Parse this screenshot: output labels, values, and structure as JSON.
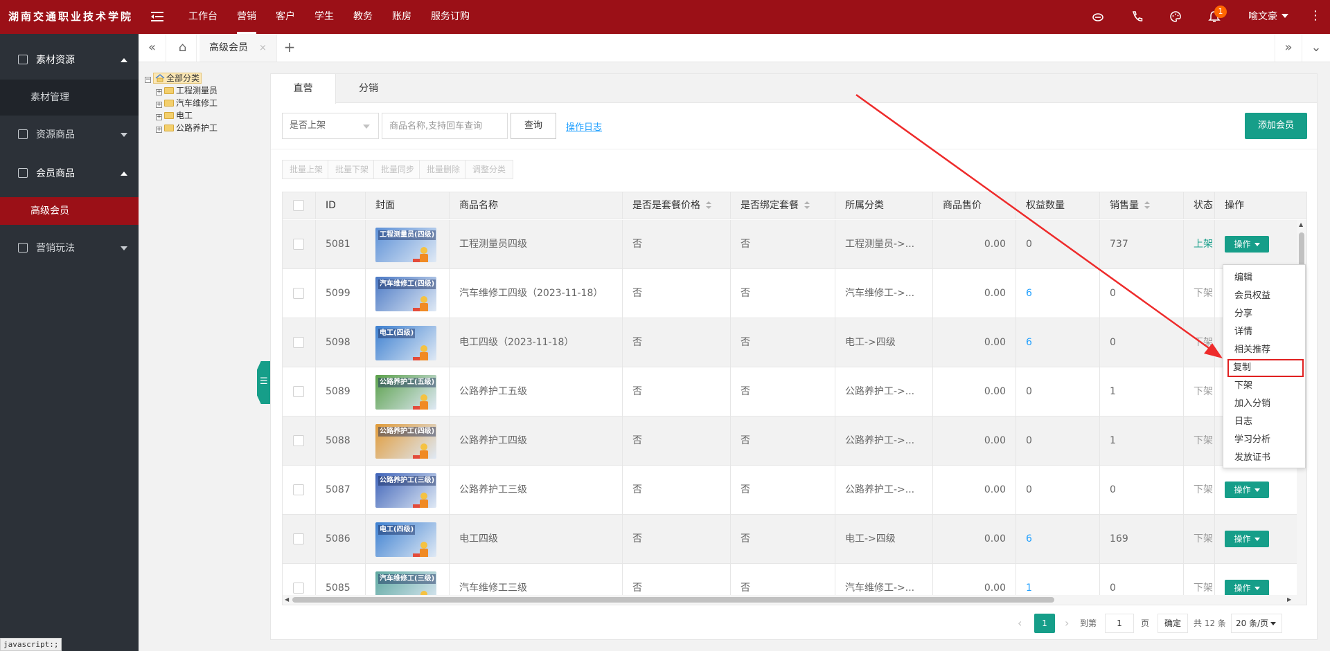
{
  "app": {
    "logo": "湖南交通职业技术学院",
    "nav": [
      "工作台",
      "营销",
      "客户",
      "学生",
      "教务",
      "账房",
      "服务订购"
    ],
    "nav_active_index": 1,
    "notification_count": "1",
    "user_name": "喻文豪",
    "accent_color": "#9b1017",
    "primary_color": "#169e89"
  },
  "sidebar": {
    "groups": [
      {
        "label": "素材资源",
        "icon": "document-icon",
        "expanded": true,
        "children": [
          "素材管理"
        ]
      },
      {
        "label": "资源商品",
        "icon": "list-icon",
        "expanded": false,
        "children": []
      },
      {
        "label": "会员商品",
        "icon": "book-icon",
        "expanded": true,
        "children": [
          "高级会员"
        ]
      },
      {
        "label": "营销玩法",
        "icon": "list-icon",
        "expanded": false,
        "children": []
      }
    ],
    "status_text": "javascript:;"
  },
  "tabbar": {
    "current_tab": "高级会员",
    "close_glyph": "×",
    "add_glyph": "+"
  },
  "tree": {
    "root": "全部分类",
    "items": [
      "工程测量员",
      "汽车维修工",
      "电工",
      "公路养护工"
    ]
  },
  "panel": {
    "tabs": [
      "直营",
      "分销"
    ],
    "active_tab_index": 0,
    "filter_status": "是否上架",
    "search_placeholder": "商品名称,支持回车查询",
    "query_label": "查询",
    "oplog_label": "操作日志",
    "add_member_label": "添加会员",
    "batch_buttons": [
      "批量上架",
      "批量下架",
      "批量同步",
      "批量删除",
      "调整分类"
    ]
  },
  "table": {
    "columns": [
      "ID",
      "封面",
      "商品名称",
      "是否是套餐价格",
      "是否绑定套餐",
      "所属分类",
      "商品售价",
      "权益数量",
      "销售量",
      "状态",
      "操作"
    ],
    "op_label": "操作",
    "rows": [
      {
        "id": "5081",
        "cover": "工程测量员(四级)",
        "name": "工程测量员四级",
        "package_price": "否",
        "bind_package": "否",
        "category": "工程测量员->...",
        "price": "0.00",
        "rights": "0",
        "sales": "737",
        "status": "上架",
        "cover_color": "#5b8fd6"
      },
      {
        "id": "5099",
        "cover": "汽车维修工(四级)",
        "name": "汽车维修工四级（2023-11-18）",
        "package_price": "否",
        "bind_package": "否",
        "category": "汽车维修工->...",
        "price": "0.00",
        "rights": "6",
        "sales": "0",
        "status": "下架",
        "cover_color": "#4a78c4"
      },
      {
        "id": "5098",
        "cover": "电工(四级)",
        "name": "电工四级（2023-11-18）",
        "package_price": "否",
        "bind_package": "否",
        "category": "电工->四级",
        "price": "0.00",
        "rights": "6",
        "sales": "0",
        "status": "下架",
        "cover_color": "#3c7fd0"
      },
      {
        "id": "5089",
        "cover": "公路养护工(五级)",
        "name": "公路养护工五级",
        "package_price": "否",
        "bind_package": "否",
        "category": "公路养护工->...",
        "price": "0.00",
        "rights": "0",
        "sales": "1",
        "status": "下架",
        "cover_color": "#5aa04a"
      },
      {
        "id": "5088",
        "cover": "公路养护工(四级)",
        "name": "公路养护工四级",
        "package_price": "否",
        "bind_package": "否",
        "category": "公路养护工->...",
        "price": "0.00",
        "rights": "0",
        "sales": "1",
        "status": "下架",
        "cover_color": "#e09a38"
      },
      {
        "id": "5087",
        "cover": "公路养护工(三级)",
        "name": "公路养护工三级",
        "package_price": "否",
        "bind_package": "否",
        "category": "公路养护工->...",
        "price": "0.00",
        "rights": "0",
        "sales": "0",
        "status": "下架",
        "cover_color": "#3f63b8"
      },
      {
        "id": "5086",
        "cover": "电工(四级)",
        "name": "电工四级",
        "package_price": "否",
        "bind_package": "否",
        "category": "电工->四级",
        "price": "0.00",
        "rights": "6",
        "sales": "169",
        "status": "下架",
        "cover_color": "#3c7fd0"
      },
      {
        "id": "5085",
        "cover": "汽车维修工(三级)",
        "name": "汽车维修工三级",
        "package_price": "否",
        "bind_package": "否",
        "category": "汽车维修工->...",
        "price": "0.00",
        "rights": "1",
        "sales": "0",
        "status": "下架",
        "cover_color": "#5ea8a0"
      }
    ]
  },
  "dropdown": {
    "items": [
      "编辑",
      "会员权益",
      "分享",
      "详情",
      "相关推荐",
      "复制",
      "下架",
      "加入分销",
      "日志",
      "学习分析",
      "发放证书"
    ],
    "highlighted_index": 5
  },
  "pager": {
    "current_page": "1",
    "goto_label": "到第",
    "goto_value": "1",
    "page_unit": "页",
    "confirm_label": "确定",
    "total_label": "共 12 条",
    "page_size": "20 条/页"
  }
}
